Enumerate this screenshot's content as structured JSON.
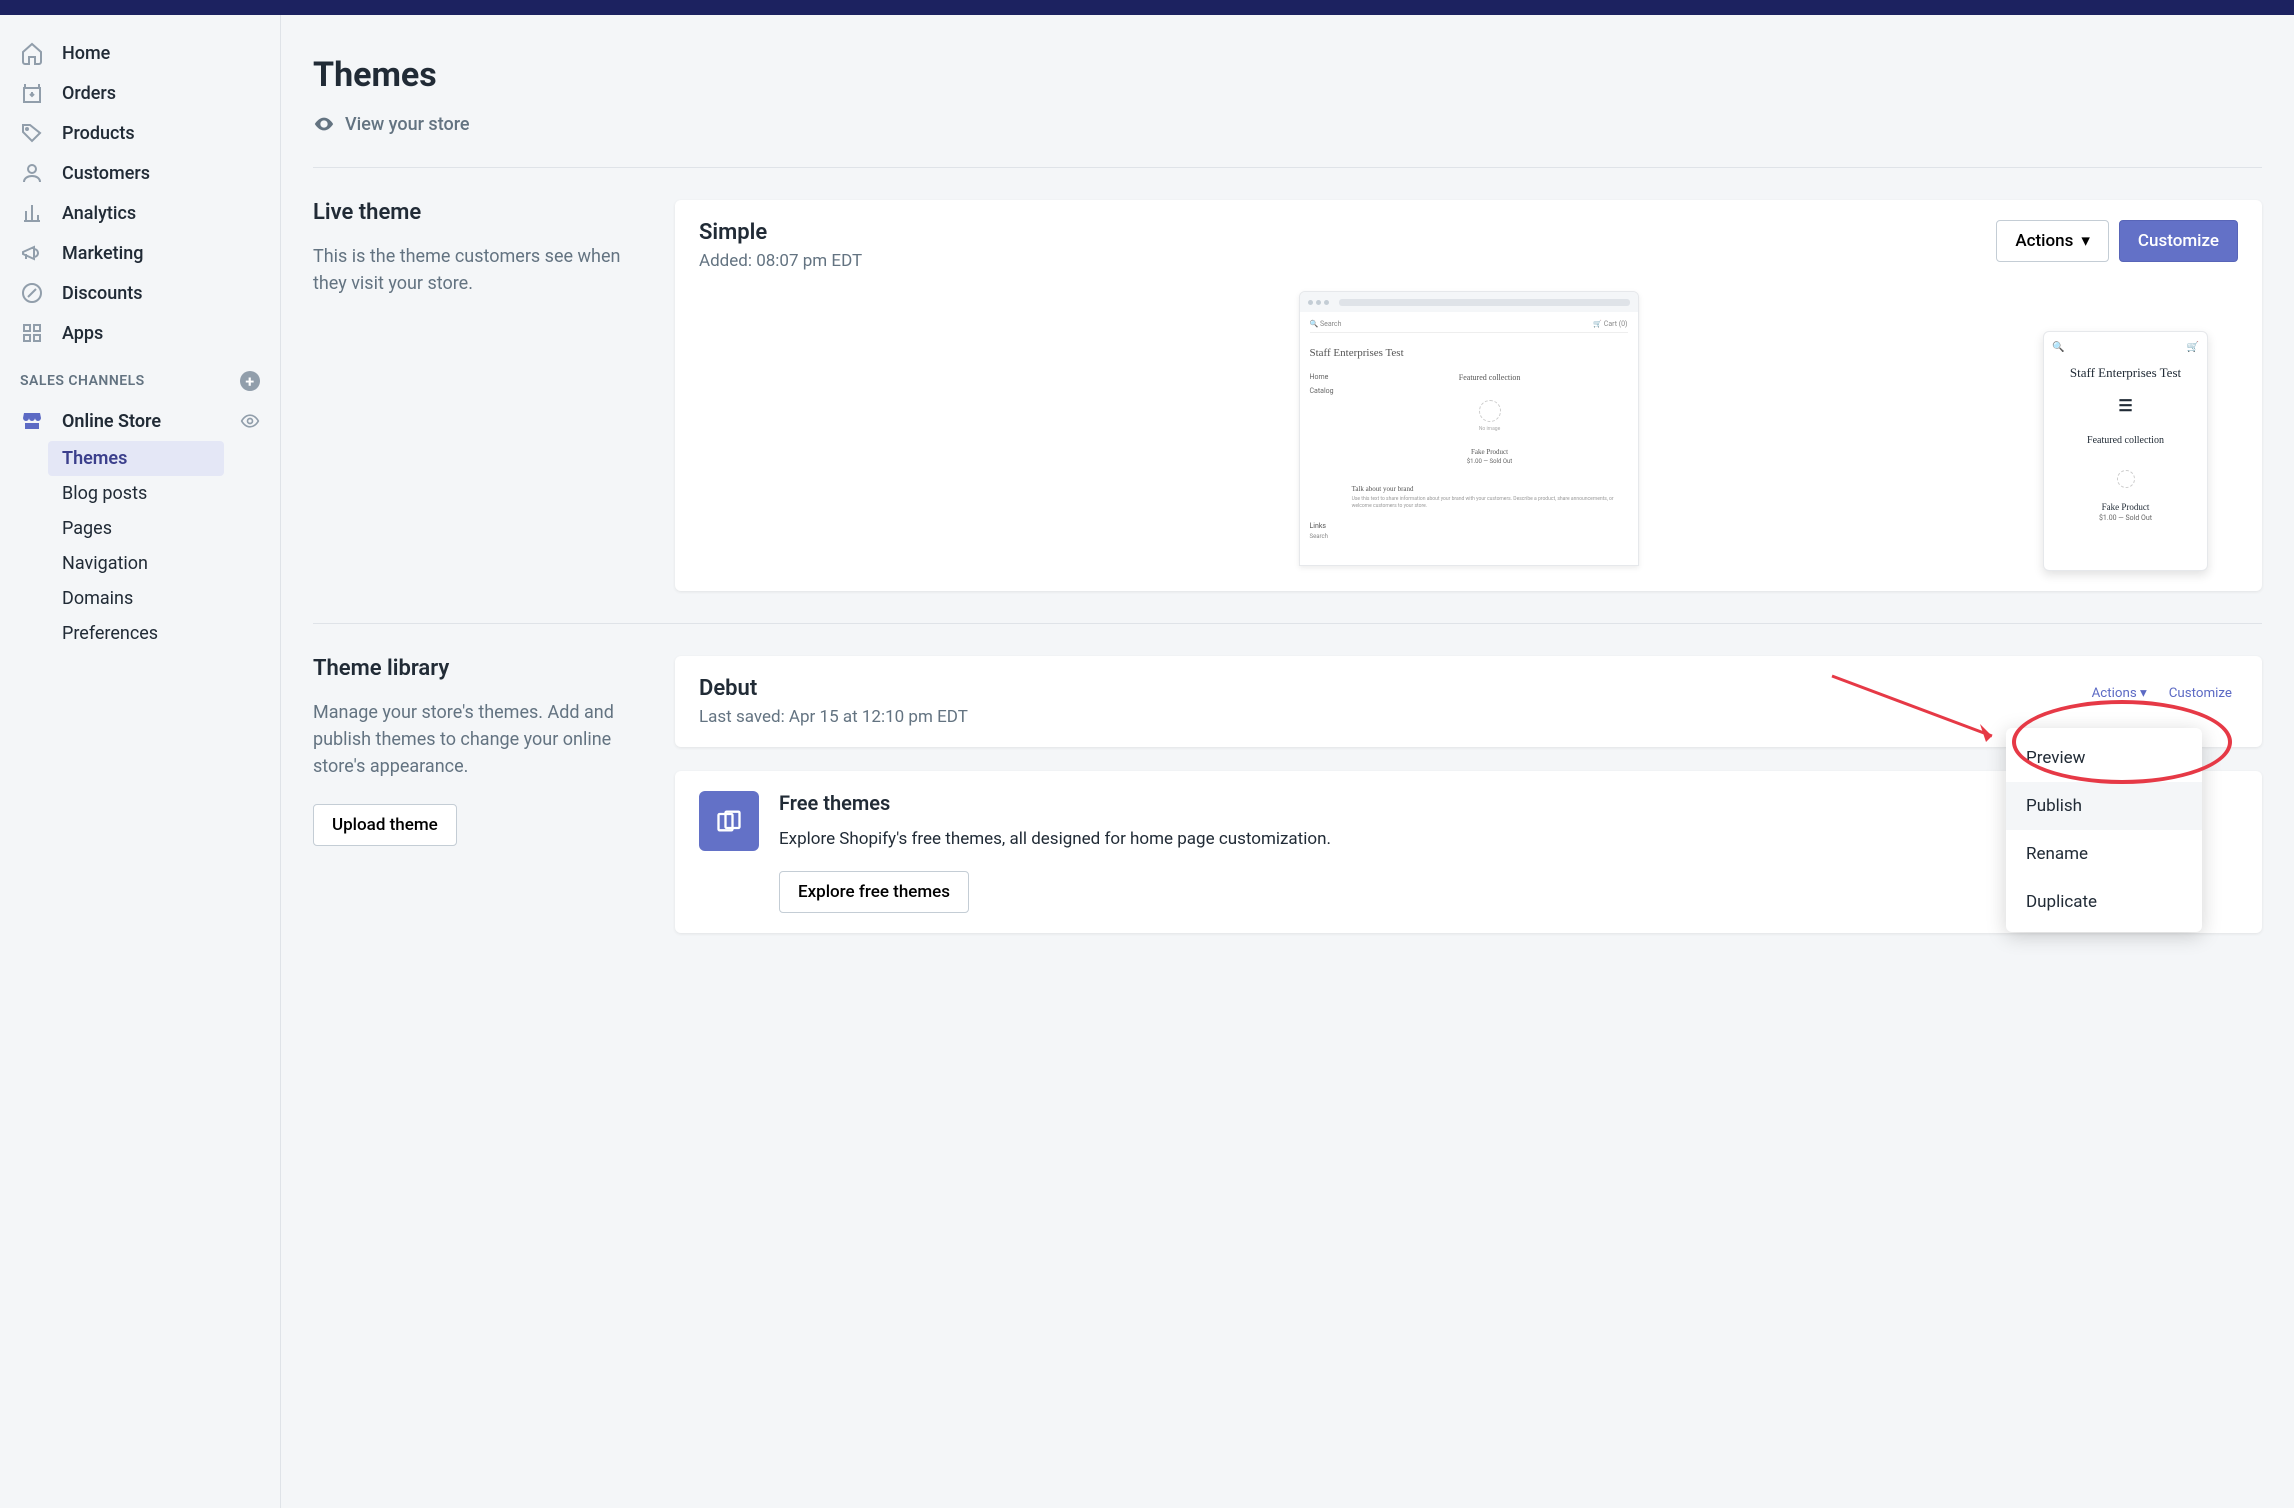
{
  "sidebar": {
    "items": [
      {
        "label": "Home"
      },
      {
        "label": "Orders"
      },
      {
        "label": "Products"
      },
      {
        "label": "Customers"
      },
      {
        "label": "Analytics"
      },
      {
        "label": "Marketing"
      },
      {
        "label": "Discounts"
      },
      {
        "label": "Apps"
      }
    ],
    "sales_channels_label": "SALES CHANNELS",
    "online_store_label": "Online Store",
    "subnav": [
      {
        "label": "Themes"
      },
      {
        "label": "Blog posts"
      },
      {
        "label": "Pages"
      },
      {
        "label": "Navigation"
      },
      {
        "label": "Domains"
      },
      {
        "label": "Preferences"
      }
    ]
  },
  "page": {
    "title": "Themes",
    "view_store": "View your store"
  },
  "live_theme": {
    "heading": "Live theme",
    "description": "This is the theme customers see when they visit your store.",
    "card_title": "Simple",
    "card_subtitle": "Added: 08:07 pm EDT",
    "actions_label": "Actions",
    "customize_label": "Customize",
    "preview": {
      "store_name": "Staff Enterprises Test",
      "search_label": "Search",
      "cart_label": "Cart (0)",
      "nav_home": "Home",
      "nav_catalog": "Catalog",
      "featured_collection": "Featured collection",
      "no_image": "No image",
      "product_name": "Fake Product",
      "product_price": "$1.00 — Sold Out",
      "brand_heading": "Talk about your brand",
      "brand_text": "Use this text to share information about your brand with your customers. Describe a product, share announcements, or welcome customers to your store.",
      "links_label": "Links",
      "links_search": "Search",
      "mobile_price": "$1.00 — Sold Out"
    }
  },
  "theme_library": {
    "heading": "Theme library",
    "description": "Manage your store's themes. Add and publish themes to change your online store's appearance.",
    "upload_label": "Upload theme",
    "debut_title": "Debut",
    "debut_subtitle": "Last saved: Apr 15 at 12:10 pm EDT",
    "actions_label": "Actions",
    "customize_label": "Customize",
    "dropdown": {
      "preview": "Preview",
      "publish": "Publish",
      "rename": "Rename",
      "duplicate": "Duplicate"
    },
    "free_themes_title": "Free themes",
    "free_themes_text": "Explore Shopify's free themes, all designed for home page customization.",
    "explore_label": "Explore free themes"
  }
}
